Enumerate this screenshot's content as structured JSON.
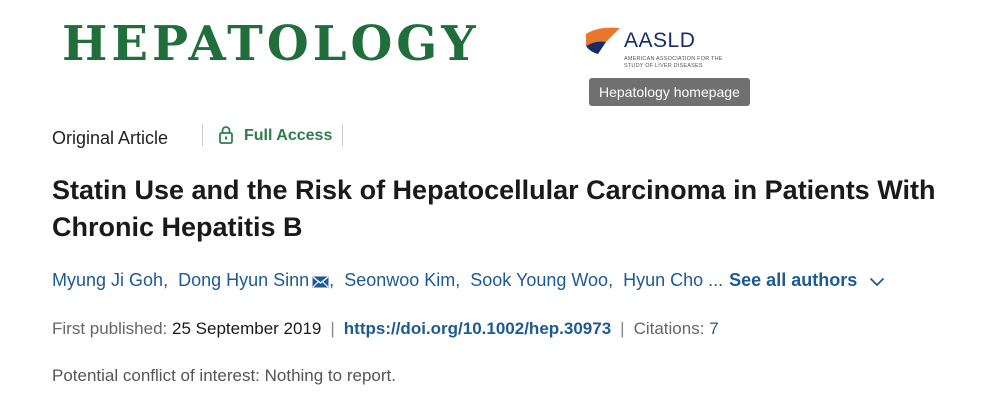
{
  "journal": {
    "title": "HEPATOLOGY",
    "logo": {
      "name": "AASLD",
      "subtitle": "American Association for the Study of Liver Diseases"
    },
    "tooltip": "Hepatology homepage"
  },
  "article": {
    "type": "Original Article",
    "access": "Full Access",
    "title": "Statin Use and the Risk of Hepatocellular Carcinoma in Patients With Chronic Hepatitis B",
    "authors": [
      "Myung Ji Goh",
      "Dong Hyun Sinn",
      "Seonwoo Kim",
      "Sook Young Woo",
      "Hyun Cho"
    ],
    "authors_more": "...",
    "see_all": "See all authors",
    "first_published_label": "First published:",
    "first_published": "25 September 2019",
    "doi": "https://doi.org/10.1002/hep.30973",
    "citations_label": "Citations:",
    "citations": "7",
    "conflict": "Potential conflict of interest: Nothing to report."
  },
  "icons": {
    "lock": "lock-open-icon",
    "mail": "envelope-icon",
    "chevron": "chevron-down-icon"
  },
  "colors": {
    "journal_green": "#1f6e3b",
    "access_green": "#2e7d4f",
    "link_blue": "#1c5a96",
    "logo_orange": "#e8762b",
    "logo_navy": "#1a2a66"
  }
}
